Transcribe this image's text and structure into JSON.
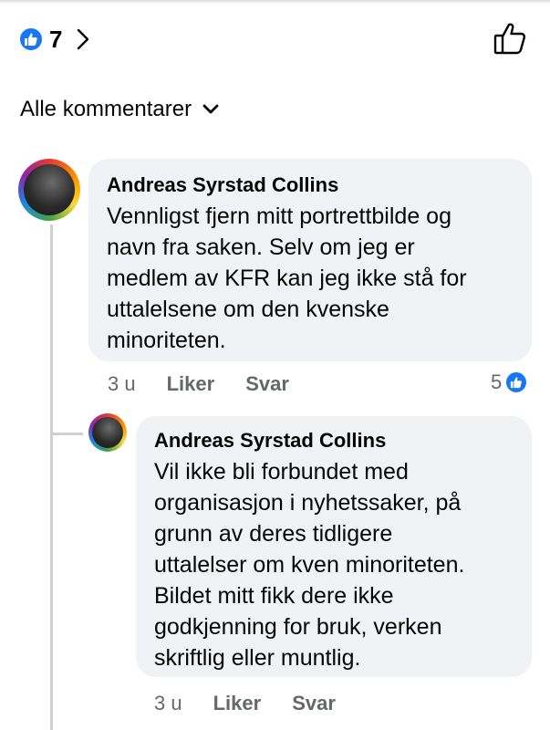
{
  "reactions": {
    "count": "7",
    "icon": "like-icon",
    "accent_color": "#1877f2"
  },
  "filter": {
    "label": "Alle kommentarer"
  },
  "comments": [
    {
      "author": "Andreas Syrstad Collins",
      "lines": [
        "Vennligst fjern mitt portrettbilde og",
        "navn fra saken. Selv om jeg er",
        "medlem av KFR kan jeg ikke stå for",
        "uttalelsene om den kvenske",
        "minoriteten."
      ],
      "time": "3 u",
      "like_label": "Liker",
      "reply_label": "Svar",
      "reaction_count": "5"
    },
    {
      "author": "Andreas Syrstad Collins",
      "lines": [
        "Vil ikke bli forbundet med",
        "organisasjon i nyhetssaker, på",
        "grunn av deres tidligere",
        "uttalelser om kven minoriteten.",
        "Bildet mitt fikk dere ikke",
        "godkjenning for bruk, verken",
        "skriftlig eller muntlig."
      ],
      "time": "3 u",
      "like_label": "Liker",
      "reply_label": "Svar"
    }
  ]
}
